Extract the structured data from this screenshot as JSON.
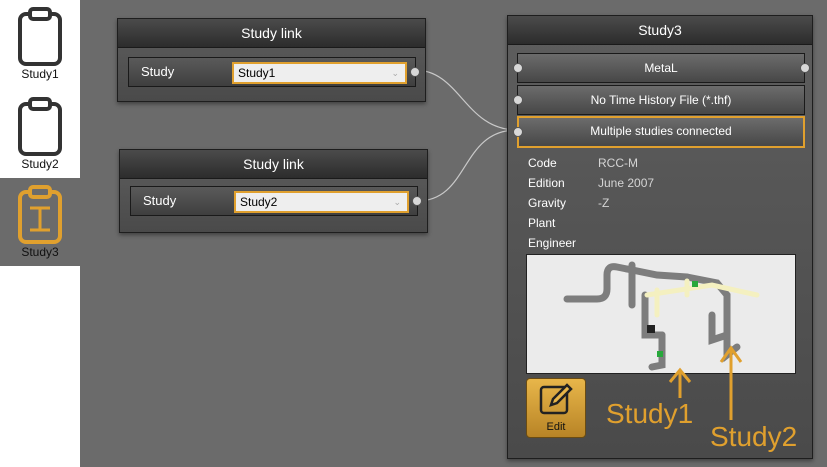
{
  "sidebar": {
    "items": [
      {
        "label": "Study1",
        "icon": "clipboard-icon",
        "active": false
      },
      {
        "label": "Study2",
        "icon": "clipboard-icon",
        "active": false
      },
      {
        "label": "Study3",
        "icon": "clipboard-text-icon",
        "active": true
      }
    ]
  },
  "link_nodes": [
    {
      "title": "Study link",
      "field_label": "Study",
      "selected": "Study1"
    },
    {
      "title": "Study link",
      "field_label": "Study",
      "selected": "Study2"
    }
  ],
  "study_node": {
    "title": "Study3",
    "material": "MetaL",
    "time_history": "No Time History File (*.thf)",
    "connection": "Multiple studies connected",
    "properties": [
      {
        "key": "Code",
        "value": "RCC-M"
      },
      {
        "key": "Edition",
        "value": "June 2007"
      },
      {
        "key": "Gravity",
        "value": "-Z"
      },
      {
        "key": "Plant",
        "value": ""
      },
      {
        "key": "Engineer",
        "value": ""
      }
    ],
    "edit_label": "Edit"
  },
  "annotations": {
    "study1": "Study1",
    "study2": "Study2"
  },
  "colors": {
    "accent": "#e0a02e",
    "background": "#6b6b6b"
  }
}
